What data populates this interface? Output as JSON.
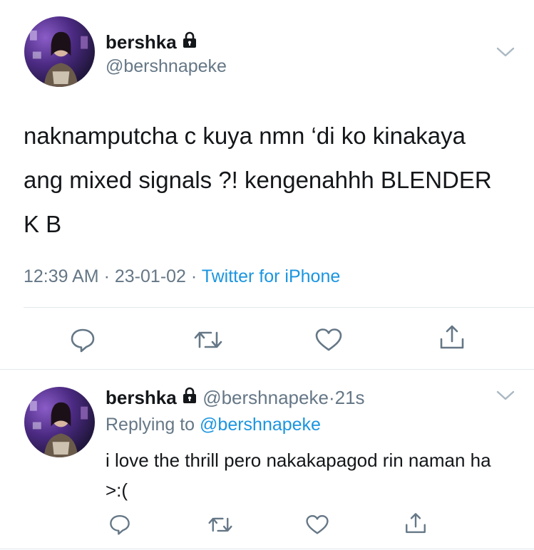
{
  "tweet": {
    "display_name": "bershka",
    "handle": "@bershnapeke",
    "text": "naknamputcha c kuya nmn ‘di ko kinakaya ang mixed signals ?! kengenahhh BLENDER K B",
    "time": "12:39 AM",
    "date": "23-01-02",
    "source": "Twitter for iPhone",
    "sep": "·"
  },
  "reply": {
    "display_name": "bershka",
    "handle": "@bershnapeke",
    "age": "21s",
    "sep": "·",
    "replying_prefix": "Replying to",
    "replying_handle": "@bershnapeke",
    "text": "i love the thrill pero nakakapagod rin naman ha >:("
  },
  "icons": {
    "reply": "reply-icon",
    "retweet": "retweet-icon",
    "like": "like-icon",
    "share": "share-icon",
    "lock": "lock-icon",
    "chevron": "chevron-down-icon"
  },
  "colors": {
    "text": "#14171a",
    "muted": "#657786",
    "link": "#1b95e0",
    "divider": "#e1e8ed"
  }
}
